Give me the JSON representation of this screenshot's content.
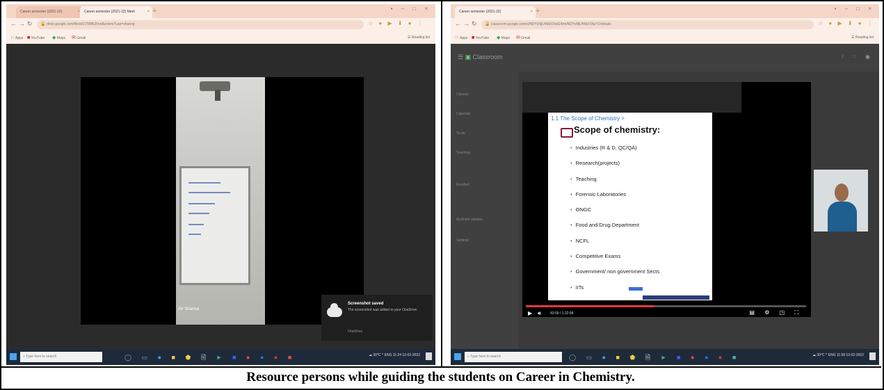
{
  "caption": "Resource persons while guiding the students on Career in Chemistry.",
  "left_screenshot": {
    "tabs": [
      {
        "label": "Career semester (2021-22)",
        "active": false
      },
      {
        "label": "Career semester (2021-22) Meet",
        "active": true
      }
    ],
    "new_tab_symbol": "+",
    "window_controls": "•  –  □  ×",
    "address": "drive.google.com/file/d/1I7R8N2hnn8a/view?usp=sharing",
    "extensions": "☆ ● ▶ ⬇ ● ⋮",
    "bookmarks": [
      {
        "icon": "apps",
        "label": "Apps"
      },
      {
        "icon": "youtube",
        "label": "YouTube"
      },
      {
        "icon": "maps",
        "label": "Maps"
      },
      {
        "icon": "gmail",
        "label": "Gmail"
      }
    ],
    "reading_list": "Reading list",
    "participant_name": "AV Sharma",
    "toast": {
      "title": "Screenshot saved",
      "body": "The screenshot was added to your OneDrive.",
      "from": "OneDrive"
    },
    "taskbar": {
      "search_placeholder": "Type here to search",
      "tray": "☁ 30°C  ^ ENG  11:24  10-02-2022"
    }
  },
  "right_screenshot": {
    "tabs": [
      {
        "label": "Career semester (2021-22)",
        "active": true
      }
    ],
    "new_tab_symbol": "+",
    "window_controls": "•  –  □  ×",
    "address": "classroom.google.com/c/NDYxNjU4MzI1NzE4/m/NDYxNjU4MzI1NzY2/details",
    "extensions": "☆ ● ▶ ⬇ ● ⋮",
    "bookmarks": [
      {
        "icon": "apps",
        "label": "Apps"
      },
      {
        "icon": "youtube",
        "label": "YouTube"
      },
      {
        "icon": "maps",
        "label": "Maps"
      },
      {
        "icon": "gmail",
        "label": "Gmail"
      }
    ],
    "reading_list": "Reading list",
    "classroom_header": "Classroom",
    "sidebar_items": [
      "Classes",
      "Calendar",
      "To-do",
      "Teaching",
      "Enrolled",
      "Archived classes",
      "Settings"
    ],
    "slide": {
      "heading": "1.1 The Scope of Chemistry >",
      "title": "Scope of chemistry:",
      "bullets": [
        "Industries (R & D, QC/QA)",
        "Research(projects)",
        "Teaching",
        "Forensic Laboratories",
        "ONGC",
        "Food and Drug Department",
        "NCFL",
        "Competitive Exams",
        "Government/ non government Sects",
        "IITs"
      ]
    },
    "player": {
      "timecode": "43:00 / 1:22:08",
      "progress": 0.46
    },
    "taskbar": {
      "search_placeholder": "Type here to search",
      "tray": "☁ 30°C  ^ ENG  11:58  10-02-2022"
    }
  }
}
